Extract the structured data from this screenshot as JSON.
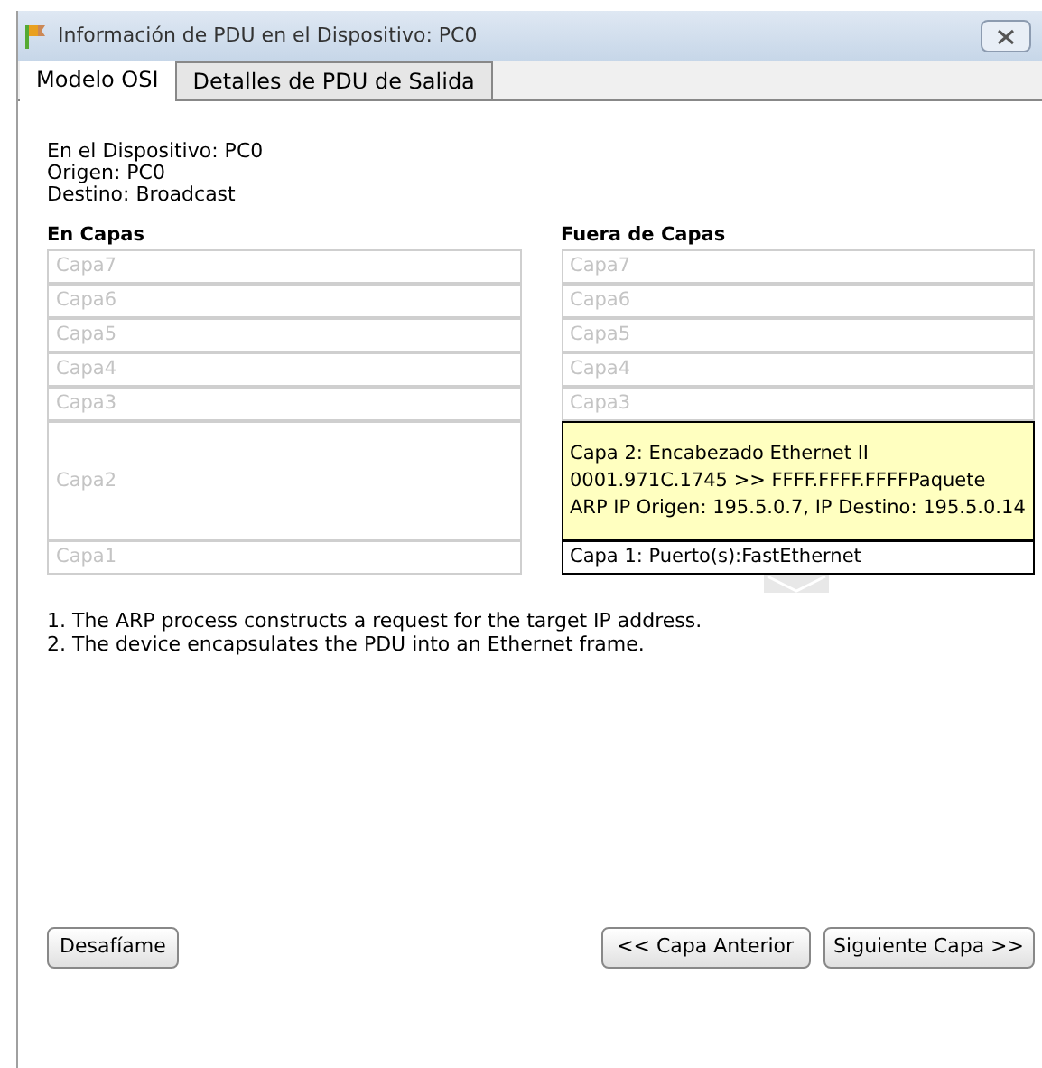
{
  "window": {
    "title": "Información de PDU en el Dispositivo: PC0"
  },
  "tabs": [
    {
      "label": "Modelo OSI",
      "selected": true
    },
    {
      "label": "Detalles de PDU de Salida",
      "selected": false
    }
  ],
  "info": [
    "En el Dispositivo: PC0",
    "Origen: PC0",
    "Destino: Broadcast"
  ],
  "in_layers": {
    "heading": "En Capas",
    "layers": [
      {
        "label": "Capa7",
        "active": false,
        "selected": false
      },
      {
        "label": "Capa6",
        "active": false,
        "selected": false
      },
      {
        "label": "Capa5",
        "active": false,
        "selected": false
      },
      {
        "label": "Capa4",
        "active": false,
        "selected": false
      },
      {
        "label": "Capa3",
        "active": false,
        "selected": false
      },
      {
        "label": "Capa2",
        "active": false,
        "selected": false
      },
      {
        "label": "Capa1",
        "active": false,
        "selected": false
      }
    ]
  },
  "out_layers": {
    "heading": "Fuera de Capas",
    "layers": [
      {
        "label": "Capa7",
        "active": false,
        "selected": false
      },
      {
        "label": "Capa6",
        "active": false,
        "selected": false
      },
      {
        "label": "Capa5",
        "active": false,
        "selected": false
      },
      {
        "label": "Capa4",
        "active": false,
        "selected": false
      },
      {
        "label": "Capa3",
        "active": false,
        "selected": false
      },
      {
        "label": "Capa 2: Encabezado Ethernet II 0001.971C.1745 >> FFFF.FFFF.FFFFPaquete ARP IP Origen: 195.5.0.7, IP Destino: 195.5.0.14",
        "active": true,
        "selected": true
      },
      {
        "label": "Capa 1: Puerto(s):FastEthernet",
        "active": true,
        "selected": false
      }
    ]
  },
  "steps": [
    "1. The ARP process constructs a request for the target IP address.",
    "2. The device encapsulates the PDU into an Ethernet frame."
  ],
  "buttons": {
    "challenge": "Desafíame",
    "previous": "<< Capa Anterior",
    "next": "Siguiente Capa >>"
  }
}
